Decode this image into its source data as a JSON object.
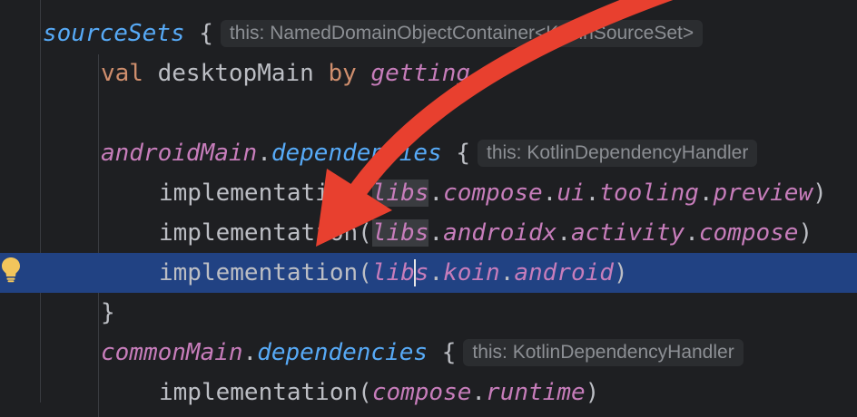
{
  "editor": {
    "lines": [
      {
        "id": "l1",
        "tokens": {
          "receiver": "sourceSets",
          "brace": " {",
          "hint": "this: NamedDomainObjectContainer<KotlinSourceSet>"
        }
      },
      {
        "id": "l2",
        "tokens": {
          "kw_val": "val",
          "name": " desktopMain ",
          "kw_by": "by",
          "getter": " getting"
        }
      },
      {
        "id": "l4",
        "tokens": {
          "receiver": "androidMain",
          "dot": ".",
          "prop": "dependencies",
          "brace": " {",
          "hint": "this: KotlinDependencyHandler"
        }
      },
      {
        "id": "l5",
        "tokens": {
          "fn": "implementation",
          "open": "(",
          "libs": "libs",
          "d1": ".",
          "p1": "compose",
          "d2": ".",
          "p2": "ui",
          "d3": ".",
          "p3": "tooling",
          "d4": ".",
          "p4": "preview",
          "close": ")"
        }
      },
      {
        "id": "l6",
        "tokens": {
          "fn": "implementation",
          "open": "(",
          "libs": "libs",
          "d1": ".",
          "p1": "androidx",
          "d2": ".",
          "p2": "activity",
          "d3": ".",
          "p3": "compose",
          "close": ")"
        }
      },
      {
        "id": "l7",
        "tokens": {
          "fn": "implementation",
          "open": "(",
          "libs_a": "lib",
          "libs_b": "s",
          "d1": ".",
          "p1": "koin",
          "d2": ".",
          "p2": "android",
          "close": ")"
        }
      },
      {
        "id": "l8",
        "tokens": {
          "brace": "}"
        }
      },
      {
        "id": "l9",
        "tokens": {
          "receiver": "commonMain",
          "dot": ".",
          "prop": "dependencies",
          "brace": " {",
          "hint": "this: KotlinDependencyHandler"
        }
      },
      {
        "id": "l10",
        "tokens": {
          "fn": "implementation",
          "open": "(",
          "p1": "compose",
          "d1": ".",
          "p2": "runtime",
          "close": ")"
        }
      }
    ]
  },
  "gutter": {
    "intention_icon": "lightbulb-icon"
  },
  "annotation": {
    "arrow_color": "#e8402f"
  }
}
